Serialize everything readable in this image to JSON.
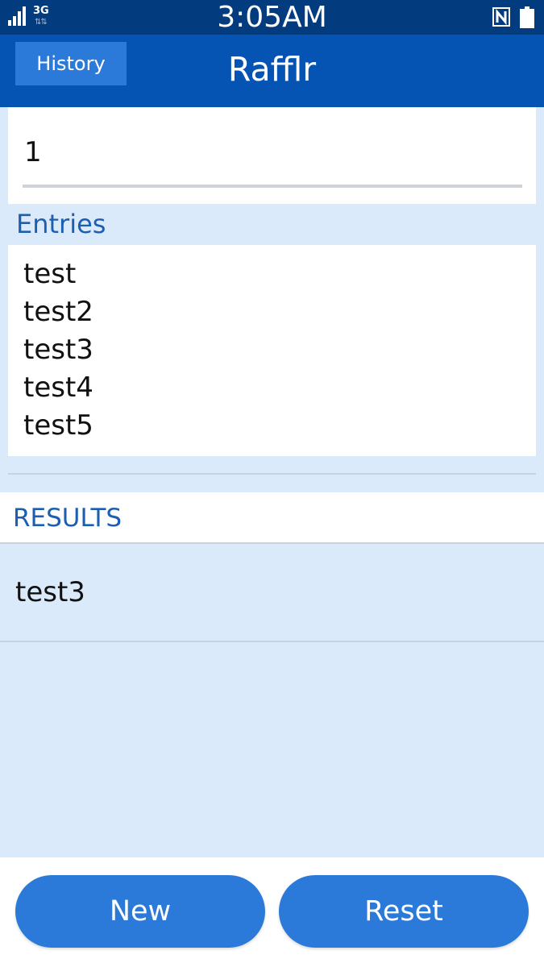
{
  "status_bar": {
    "time": "3:05AM",
    "network_type": "3G",
    "icons": [
      "signal-icon",
      "network-activity-icon",
      "nfc-icon",
      "battery-icon"
    ]
  },
  "header": {
    "history_label": "History",
    "title": "Rafflr"
  },
  "count_input": {
    "value": "1"
  },
  "entries": {
    "label": "Entries",
    "items": [
      "test",
      "test2",
      "test3",
      "test4",
      "test5"
    ]
  },
  "results": {
    "label": "RESULTS",
    "items": [
      "test3"
    ]
  },
  "footer": {
    "new_label": "New",
    "reset_label": "Reset"
  },
  "colors": {
    "status_bar": "#023c7e",
    "header": "#0553b3",
    "accent_button": "#2b7ad9",
    "section_label": "#1c5fb0",
    "background": "#dbeafb"
  }
}
